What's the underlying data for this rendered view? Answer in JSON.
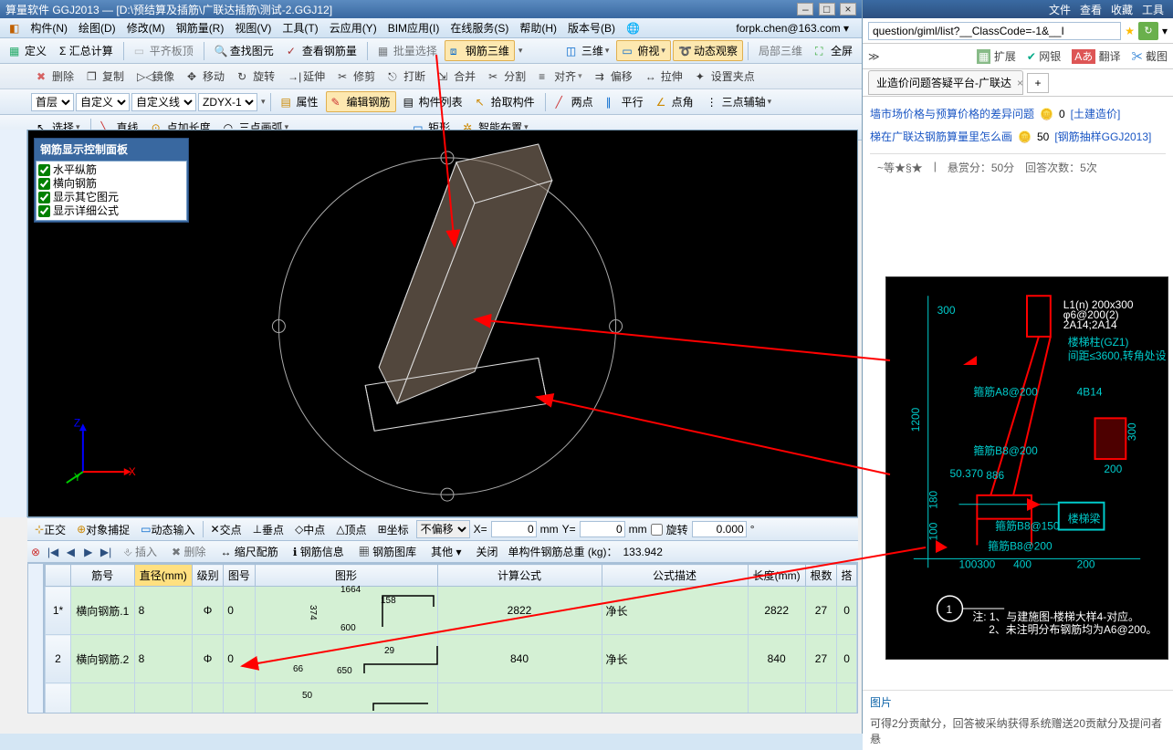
{
  "title": "算量软件 GGJ2013 — [D:\\预结算及插筋\\广联达插筋\\测试-2.GGJ12]",
  "menus": [
    "构件(N)",
    "绘图(D)",
    "修改(M)",
    "钢筋量(R)",
    "视图(V)",
    "工具(T)",
    "云应用(Y)",
    "BIM应用(I)",
    "在线服务(S)",
    "帮助(H)",
    "版本号(B)"
  ],
  "user": "forpk.chen@163.com ▾",
  "tb1": {
    "define": "定义",
    "sumcalc": "Σ 汇总计算",
    "flatslab": "平齐板顶",
    "findent": "查找图元",
    "viewrebar": "查看钢筋量",
    "batchsel": "批量选择",
    "rebar3d": "钢筋三维",
    "threeD": "三维",
    "top": "俯视",
    "dynview": "动态观察",
    "part3d": "局部三维",
    "full": "全屏"
  },
  "tb2": {
    "del": "删除",
    "copy": "复制",
    "mirror": "镜像",
    "move": "移动",
    "rotate": "旋转",
    "extend": "延伸",
    "trim": "修剪",
    "break": "打断",
    "merge": "合并",
    "split": "分割",
    "align": "对齐",
    "offset": "偏移",
    "stretch": "拉伸",
    "setclamp": "设置夹点"
  },
  "tb3": {
    "floor": "首层",
    "custom": "自定义",
    "customline": "自定义线",
    "code": "ZDYX-1",
    "attr": "属性",
    "editrebar": "编辑钢筋",
    "complist": "构件列表",
    "pickcomp": "拾取构件",
    "twopt": "两点",
    "parallel": "平行",
    "ptangle": "点角",
    "triaux": "三点辅轴"
  },
  "tb4": {
    "select": "选择",
    "line": "直线",
    "ptlen": "点加长度",
    "arc3": "三点画弧",
    "rect": "矩形",
    "smart": "智能布置"
  },
  "panel": {
    "title": "钢筋显示控制面板",
    "items": [
      "水平纵筋",
      "横向钢筋",
      "显示其它图元",
      "显示详细公式"
    ]
  },
  "snap": {
    "ortho": "正交",
    "osnap": "对象捕捉",
    "dyninput": "动态输入",
    "intersect": "交点",
    "perp": "垂点",
    "mid": "中点",
    "apex": "顶点",
    "coord": "坐标",
    "nooffset": "不偏移",
    "xlabel": "X=",
    "xval": "0",
    "ylabel": "Y=",
    "yval": "0",
    "rotlabel": "旋转",
    "rotval": "0.000",
    "mm": "mm"
  },
  "rebartools": {
    "insert": "插入",
    "delete": "删除",
    "scalebar": "缩尺配筋",
    "info": "钢筋信息",
    "lib": "钢筋图库",
    "other": "其他",
    "close": "关闭",
    "weightlabel": "单构件钢筋总重 (kg)：",
    "weight": "133.942"
  },
  "gridhdr": [
    "筋号",
    "直径(mm)",
    "级别",
    "图号",
    "图形",
    "计算公式",
    "公式描述",
    "长度(mm)",
    "根数",
    "搭"
  ],
  "rows": [
    {
      "n": "1*",
      "name": "横向钢筋.1",
      "dia": "8",
      "lvl": "Φ",
      "fig": "0",
      "shape": {
        "top": "1664",
        "right": "158",
        "left": "374",
        "bottom": "600"
      },
      "formula": "2822",
      "desc": "净长",
      "len": "2822",
      "cnt": "27",
      "lap": "0"
    },
    {
      "n": "2",
      "name": "横向钢筋.2",
      "dia": "8",
      "lvl": "Φ",
      "fig": "0",
      "shape": {
        "right": "29",
        "bottom": "650",
        "left": "66"
      },
      "formula": "840",
      "desc": "净长",
      "len": "840",
      "cnt": "27",
      "lap": "0"
    }
  ],
  "right": {
    "topmenu": [
      "文件",
      "查看",
      "收藏",
      "工具"
    ],
    "url": "question/giml/list?__ClassCode=-1&__I",
    "ext": [
      "扩展",
      "网银",
      "翻译",
      "截图"
    ],
    "tabtitle": "业造价问题答疑平台-广联达",
    "q1": {
      "text": "墙市场价格与预算价格的差异问题",
      "pts": "0",
      "cat": "[土建造价]"
    },
    "q2": {
      "text": "梯在广联达钢筋算量里怎么画",
      "pts": "50",
      "cat": "[钢筋抽样GGJ2013]"
    },
    "meta": {
      "level": "~等★§★",
      "bounty": "悬赏分：50分",
      "answers": "回答次数：5次"
    },
    "piclabel": "图片",
    "foot": "可得2分贡献分，回答被采纳获得系统赠送20贡献分及提问者悬"
  },
  "diagram": {
    "label": "楼梯柱(GZ1)",
    "note": "间距≤3600,转角处设",
    "rebar1": "箍筋A8@200",
    "rebar2": "4B14",
    "rebar3": "箍筋B8@200",
    "rebar4": "箍筋B8@200",
    "rebar5": "箍筋B8@150",
    "elev": "50.370",
    "dims": {
      "a": "300",
      "b": "1200",
      "c": "886",
      "d": "180",
      "e": "100",
      "f": "400",
      "g": "200",
      "h": "300",
      "i": "100"
    },
    "circ": "1",
    "notes": "注: 1、与建施图-楼梯大样4-对应。\n2、未注明分布钢筋均为A6@200。"
  }
}
